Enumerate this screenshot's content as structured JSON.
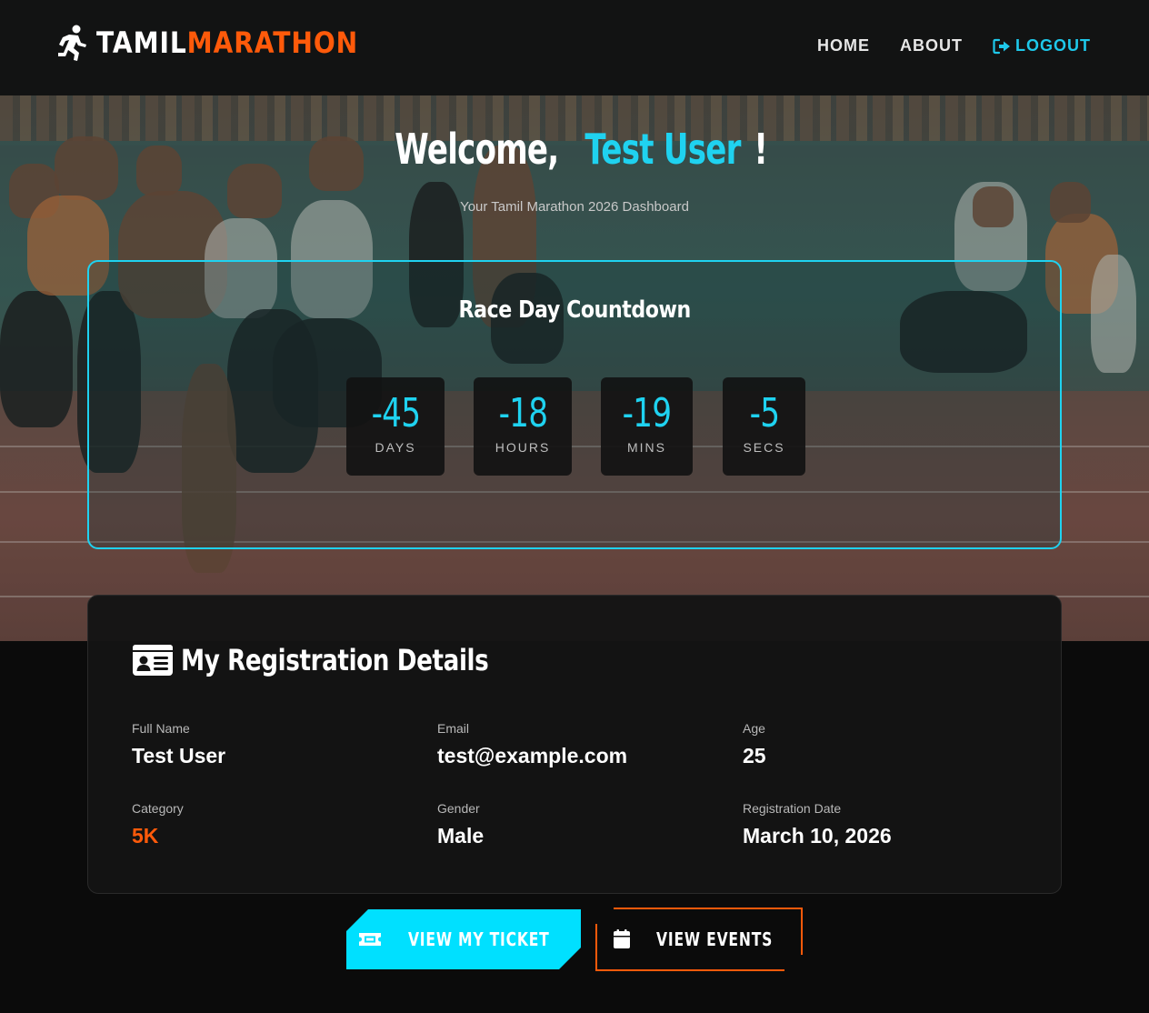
{
  "brand": {
    "part1": "TAMIL",
    "part2": "MARATHON",
    "icon": "running-person-icon"
  },
  "nav": {
    "home": "HOME",
    "about": "ABOUT",
    "logout": "LOGOUT",
    "logout_icon": "sign-out-icon"
  },
  "welcome": {
    "prefix": "Welcome, ",
    "name": "Test User",
    "suffix": "!"
  },
  "subtitle": "Your Tamil Marathon 2026 Dashboard",
  "countdown": {
    "title": "Race Day Countdown",
    "units": [
      {
        "value": "-45",
        "label": "DAYS"
      },
      {
        "value": "-18",
        "label": "HOURS"
      },
      {
        "value": "-19",
        "label": "MINS"
      },
      {
        "value": "-5",
        "label": "SECS"
      }
    ]
  },
  "registration": {
    "title": "My Registration Details",
    "title_icon": "id-card-icon",
    "fields": {
      "full_name": {
        "label": "Full Name",
        "value": "Test User"
      },
      "email": {
        "label": "Email",
        "value": "test@example.com"
      },
      "age": {
        "label": "Age",
        "value": "25"
      },
      "category": {
        "label": "Category",
        "value": "5K"
      },
      "gender": {
        "label": "Gender",
        "value": "Male"
      },
      "registration_date": {
        "label": "Registration Date",
        "value": "March 10, 2026"
      }
    }
  },
  "buttons": {
    "ticket": {
      "label": "VIEW MY TICKET",
      "icon": "ticket-icon"
    },
    "events": {
      "label": "VIEW EVENTS",
      "icon": "calendar-icon"
    }
  },
  "colors": {
    "accent": "#1fd2f0",
    "brand_orange": "#ff5a0a",
    "button_cyan": "#00e0ff",
    "background": "#0b0b0b"
  }
}
